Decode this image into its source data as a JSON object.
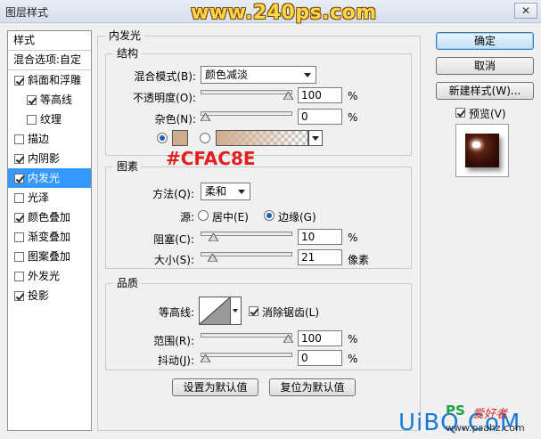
{
  "window": {
    "title": "图层样式",
    "watermark": "www.240ps.com",
    "close_glyph": "✕"
  },
  "style_list": {
    "header": "样式",
    "blend_options": "混合选项:自定",
    "items": [
      {
        "label": "斜面和浮雕",
        "checked": true,
        "indent": false,
        "selected": false
      },
      {
        "label": "等高线",
        "checked": true,
        "indent": true,
        "selected": false
      },
      {
        "label": "纹理",
        "checked": false,
        "indent": true,
        "selected": false
      },
      {
        "label": "描边",
        "checked": false,
        "indent": false,
        "selected": false
      },
      {
        "label": "内阴影",
        "checked": true,
        "indent": false,
        "selected": false
      },
      {
        "label": "内发光",
        "checked": true,
        "indent": false,
        "selected": true
      },
      {
        "label": "光泽",
        "checked": false,
        "indent": false,
        "selected": false
      },
      {
        "label": "颜色叠加",
        "checked": true,
        "indent": false,
        "selected": false
      },
      {
        "label": "渐变叠加",
        "checked": false,
        "indent": false,
        "selected": false
      },
      {
        "label": "图案叠加",
        "checked": false,
        "indent": false,
        "selected": false
      },
      {
        "label": "外发光",
        "checked": false,
        "indent": false,
        "selected": false
      },
      {
        "label": "投影",
        "checked": true,
        "indent": false,
        "selected": false
      }
    ]
  },
  "panel": {
    "title": "内发光",
    "structure": {
      "title": "结构",
      "blend_mode_label": "混合模式(B):",
      "blend_mode_value": "颜色减淡",
      "opacity_label": "不透明度(O):",
      "opacity_value": "100",
      "opacity_unit": "%",
      "opacity_level": 1.0,
      "noise_label": "杂色(N):",
      "noise_value": "0",
      "noise_unit": "%",
      "noise_level": 0.0,
      "glow_color": "#cfac8e",
      "color_annotation": "#CFAC8E"
    },
    "elements": {
      "title": "图素",
      "technique_label": "方法(Q):",
      "technique_value": "柔和",
      "source_label": "源:",
      "source_center": "居中(E)",
      "source_edge": "边缘(G)",
      "choke_label": "阻塞(C):",
      "choke_value": "10",
      "choke_unit": "%",
      "choke_level": 0.1,
      "size_label": "大小(S):",
      "size_value": "21",
      "size_unit": "像素",
      "size_level": 0.084
    },
    "quality": {
      "title": "品质",
      "contour_label": "等高线:",
      "antialias_label": "消除锯齿(L)",
      "range_label": "范围(R):",
      "range_value": "100",
      "range_unit": "%",
      "range_level": 1.0,
      "jitter_label": "抖动(J):",
      "jitter_value": "0",
      "jitter_unit": "%",
      "jitter_level": 0.0
    },
    "make_default": "设置为默认值",
    "reset_default": "复位为默认值"
  },
  "buttons": {
    "ok": "确定",
    "cancel": "取消",
    "new_style": "新建样式(W)...",
    "preview": "预览(V)"
  },
  "logos": {
    "ps": "PS",
    "cn": "爱好者",
    "uibq": "UiBQ.CoM",
    "url": "www.psahz.com"
  }
}
